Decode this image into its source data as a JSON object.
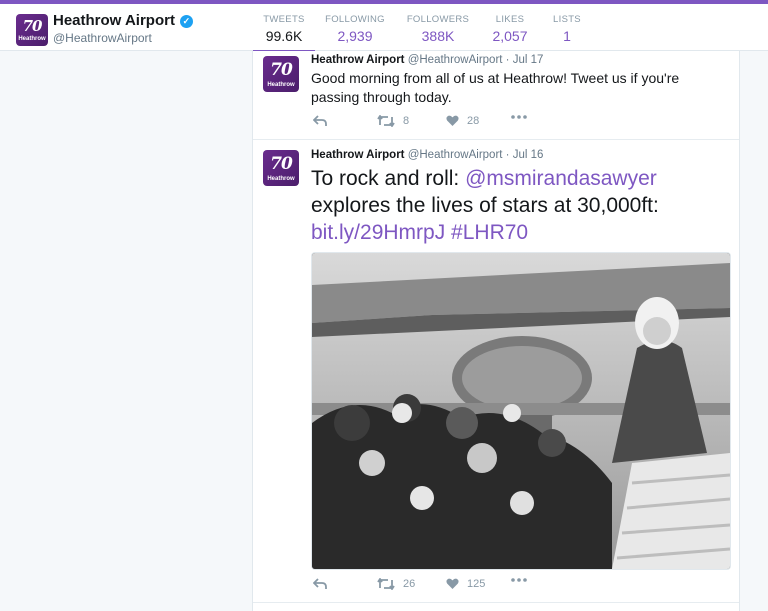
{
  "profile": {
    "name": "Heathrow Airport",
    "handle": "@HeathrowAirport",
    "logo_number": "70",
    "logo_word": "Heathrow"
  },
  "stats": [
    {
      "label": "TWEETS",
      "value": "99.6K",
      "active": true
    },
    {
      "label": "FOLLOWING",
      "value": "2,939"
    },
    {
      "label": "FOLLOWERS",
      "value": "388K"
    },
    {
      "label": "LIKES",
      "value": "2,057"
    },
    {
      "label": "LISTS",
      "value": "1"
    }
  ],
  "tweets": [
    {
      "author": "Heathrow Airport",
      "handle": "@HeathrowAirport",
      "sep": "·",
      "date": "Jul 17",
      "text": "Good morning from all of us at Heathrow! Tweet us if you're passing through today.",
      "retweets": "8",
      "likes": "28"
    },
    {
      "author": "Heathrow Airport",
      "handle": "@HeathrowAirport",
      "sep": "·",
      "date": "Jul 16",
      "text_parts": [
        "To rock and roll: ",
        "@msmirandasawyer",
        " explores the lives of stars at 30,000ft: ",
        "bit.ly/29HmrpJ",
        " ",
        "#LHR70"
      ],
      "retweets": "26",
      "likes": "125"
    }
  ],
  "colors": {
    "accent": "#7e57c2",
    "verified": "#1da1f2",
    "muted": "#8899a6"
  }
}
